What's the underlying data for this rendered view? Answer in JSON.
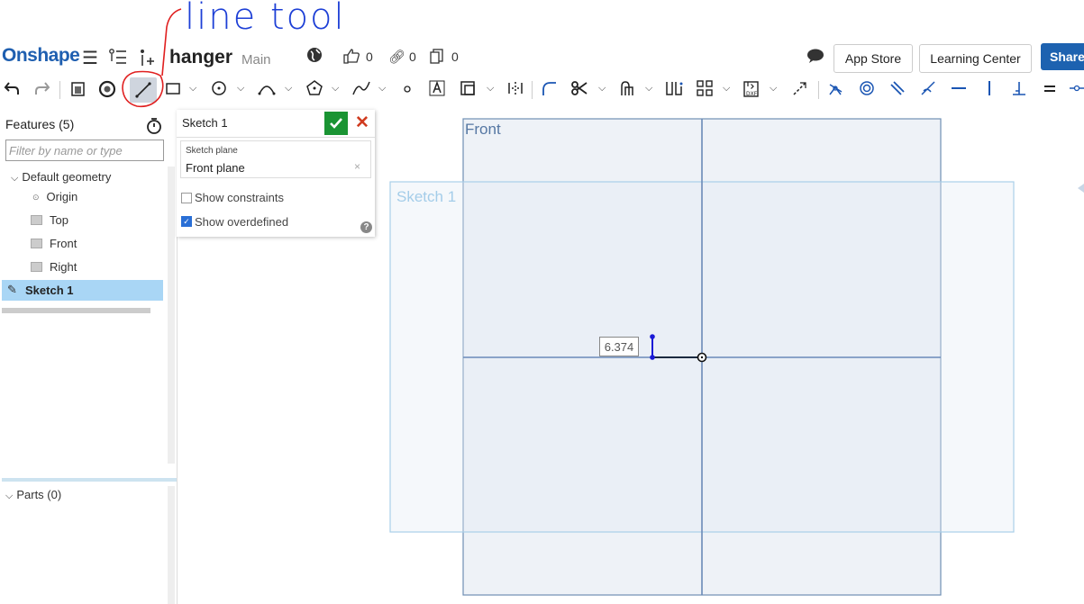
{
  "annotation": {
    "text": "line tool",
    "color": "#1d3fd6",
    "circle_color": "#e02020"
  },
  "header": {
    "logo": "Onshape",
    "doc_title": "hanger",
    "branch": "Main",
    "likes": "0",
    "links": "0",
    "copies": "0",
    "app_store": "App Store",
    "learning_center": "Learning Center",
    "share": "Share",
    "brand_color": "#1f5fb0"
  },
  "toolbar": {
    "active_tool": "line-tool",
    "icons": [
      "undo-icon",
      "redo-icon",
      "copy-sketch-icon",
      "circle-arrow-icon",
      "line-icon",
      "rectangle-icon",
      "circle-icon",
      "arc-icon",
      "polygon-icon",
      "spline-icon",
      "point-icon",
      "text-icon",
      "offset-icon",
      "mirror-icon",
      "fillet-icon",
      "trim-icon",
      "extend-icon",
      "split-icon",
      "pattern-icon",
      "dxf-import-icon",
      "construction-icon",
      "coincident-icon",
      "concentric-icon",
      "parallel-icon",
      "tangent-icon",
      "horizontal-icon",
      "vertical-icon",
      "perpendicular-icon",
      "equal-icon",
      "midpoint-icon"
    ]
  },
  "features": {
    "title": "Features (5)",
    "filter_placeholder": "Filter by name or type",
    "default_geometry": "Default geometry",
    "origin": "Origin",
    "top": "Top",
    "front": "Front",
    "right": "Right",
    "sketch": "Sketch 1",
    "parts": "Parts (0)"
  },
  "dialog": {
    "title": "Sketch 1",
    "plane_label": "Sketch plane",
    "plane_value": "Front plane",
    "show_constraints": "Show constraints",
    "show_constraints_checked": false,
    "show_overdefined": "Show overdefined",
    "show_overdefined_checked": true
  },
  "canvas": {
    "front_label": "Front",
    "sketch_label": "Sketch 1",
    "dimension": "6.374"
  }
}
